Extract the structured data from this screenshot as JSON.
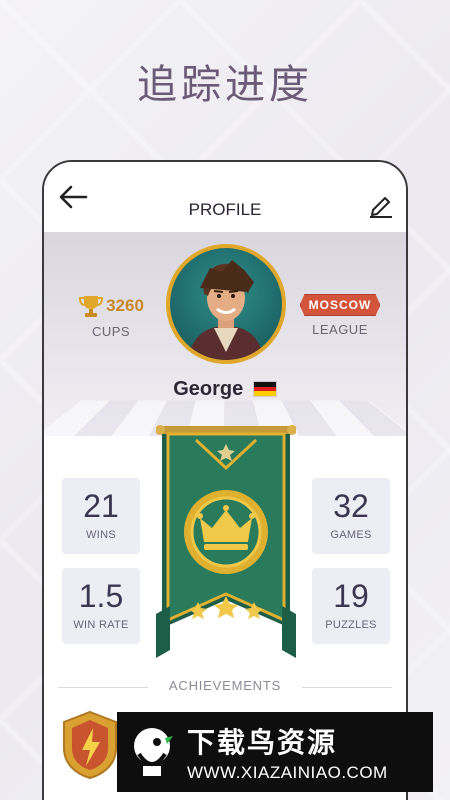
{
  "headline": "追踪进度",
  "header": {
    "title": "PROFILE"
  },
  "profile": {
    "cups": {
      "value": "3260",
      "label": "CUPS"
    },
    "league": {
      "badge": "MOSCOW",
      "label": "LEAGUE"
    },
    "name": "George"
  },
  "stats": [
    {
      "value": "21",
      "label": "WINS"
    },
    {
      "value": "32",
      "label": "GAMES"
    },
    {
      "value": "1.5",
      "label": "WIN RATE"
    },
    {
      "value": "19",
      "label": "PUZZLES"
    }
  ],
  "achievements": {
    "title": "ACHIEVEMENTS"
  },
  "watermark": {
    "title": "下载鸟资源",
    "url": "WWW.XIAZAINIAO.COM"
  },
  "colors": {
    "accent": "#c9892a",
    "league": "#d4543b",
    "banner": "#2a7a5c",
    "gold": "#e0b030"
  }
}
